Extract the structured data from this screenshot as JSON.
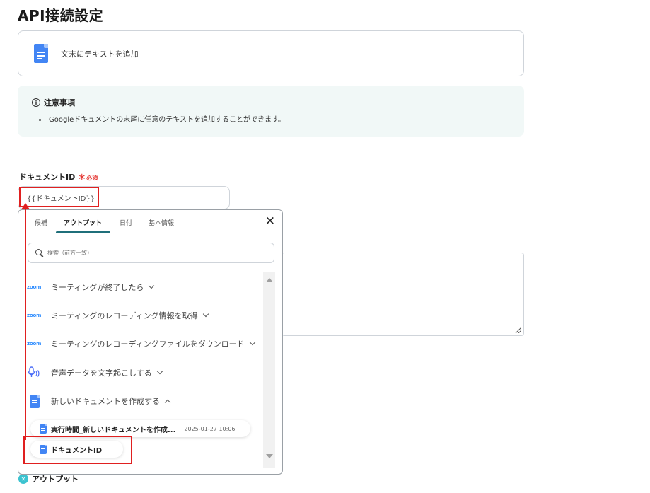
{
  "page": {
    "title": "API接続設定"
  },
  "action": {
    "label": "文末にテキストを追加",
    "icon": "google-docs-icon"
  },
  "notice": {
    "title": "注意事項",
    "items": [
      "Googleドキュメントの末尾に任意のテキストを追加することができます。"
    ]
  },
  "field": {
    "label": "ドキュメントID",
    "required_mark": "＊",
    "required_text": "必須",
    "value": "{{ドキュメントID}}"
  },
  "popup": {
    "tabs": [
      "候補",
      "アウトプット",
      "日付",
      "基本情報"
    ],
    "active_tab": "アウトプット",
    "close": "✕",
    "search_placeholder": "検索（前方一致）",
    "zoom_logo": "zoom",
    "steps": [
      {
        "label": "ミーティングが終了したら",
        "icon": "zoom-logo",
        "expanded": false
      },
      {
        "label": "ミーティングのレコーディング情報を取得",
        "icon": "zoom-logo",
        "expanded": false
      },
      {
        "label": "ミーティングのレコーディングファイルをダウンロード",
        "icon": "zoom-logo",
        "expanded": false
      },
      {
        "label": "音声データを文字起こしする",
        "icon": "mic-icon",
        "expanded": false
      },
      {
        "label": "新しいドキュメントを作成する",
        "icon": "google-docs-icon",
        "expanded": true
      }
    ],
    "outputs": [
      {
        "label": "実行時間_新しいドキュメントを作成...",
        "timestamp": "2025-01-27 10:06"
      },
      {
        "label": "ドキュメントID"
      }
    ]
  },
  "output_section": {
    "label": "アウトプット"
  },
  "colors": {
    "accent": "#1f6f7a",
    "highlight": "#e02020",
    "docs_blue": "#4285f4",
    "zoom_blue": "#2d8cff",
    "notice_bg": "#f1f8f7"
  }
}
